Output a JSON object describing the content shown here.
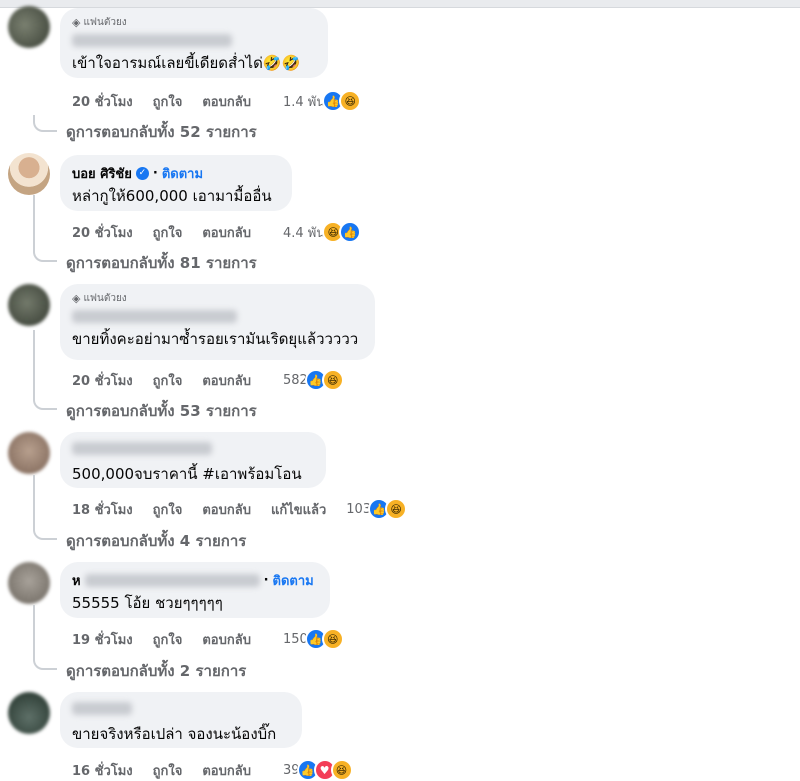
{
  "labels": {
    "fan_badge": "แฟนตัวยง",
    "like": "ถูกใจ",
    "reply": "ตอบกลับ",
    "follow": "ติดตาม",
    "edited": "แก้ไขแล้ว",
    "dot": "·"
  },
  "comments": [
    {
      "text": "เข้าใจอารมณ์เลยขี้เดียดส่ำได่🤣🤣",
      "time": "20 ชั่วโมง",
      "reaction_count": "1.4 พัน",
      "reactions": [
        "like-icon",
        "haha-icon"
      ],
      "replies": "ดูการตอบกลับทั้ง 52 รายการ"
    },
    {
      "name": "บอย ศิริชัย",
      "text": "หล่ากูให้600,000 เอามามื้ออื่น",
      "time": "20 ชั่วโมง",
      "reaction_count": "4.4 พัน",
      "reactions": [
        "haha-icon",
        "like-icon"
      ],
      "replies": "ดูการตอบกลับทั้ง 81 รายการ"
    },
    {
      "text": "ขายทิ้งคะอย่ามาซ้ำรอยเรามันเริดยุแล้ววววว",
      "time": "20 ชั่วโมง",
      "reaction_count": "582",
      "reactions": [
        "like-icon",
        "haha-icon"
      ],
      "replies": "ดูการตอบกลับทั้ง 53 รายการ"
    },
    {
      "text": "500,000จบราคานี้ #เอาพร้อมโอน",
      "time": "18 ชั่วโมง",
      "reaction_count": "103",
      "reactions": [
        "like-icon",
        "haha-icon"
      ],
      "replies": "ดูการตอบกลับทั้ง 4 รายการ"
    },
    {
      "name_initial": "ห",
      "text": "55555 โอ้ย ชวยๆๆๆๆๆ",
      "time": "19 ชั่วโมง",
      "reaction_count": "150",
      "reactions": [
        "like-icon",
        "haha-icon"
      ],
      "replies": "ดูการตอบกลับทั้ง 2 รายการ"
    },
    {
      "text": "ขายจริงหรือเปล่า จองนะน้องบิ๊ก",
      "time": "16 ชั่วโมง",
      "reaction_count": "39",
      "reactions": [
        "like-icon",
        "love-icon",
        "haha-icon"
      ]
    }
  ],
  "colors": {
    "accent": "#1877f2",
    "bubble": "#f0f2f5",
    "meta_text": "#65676b",
    "like": "#1877f2",
    "haha": "#f7b125",
    "love": "#f33e58"
  }
}
